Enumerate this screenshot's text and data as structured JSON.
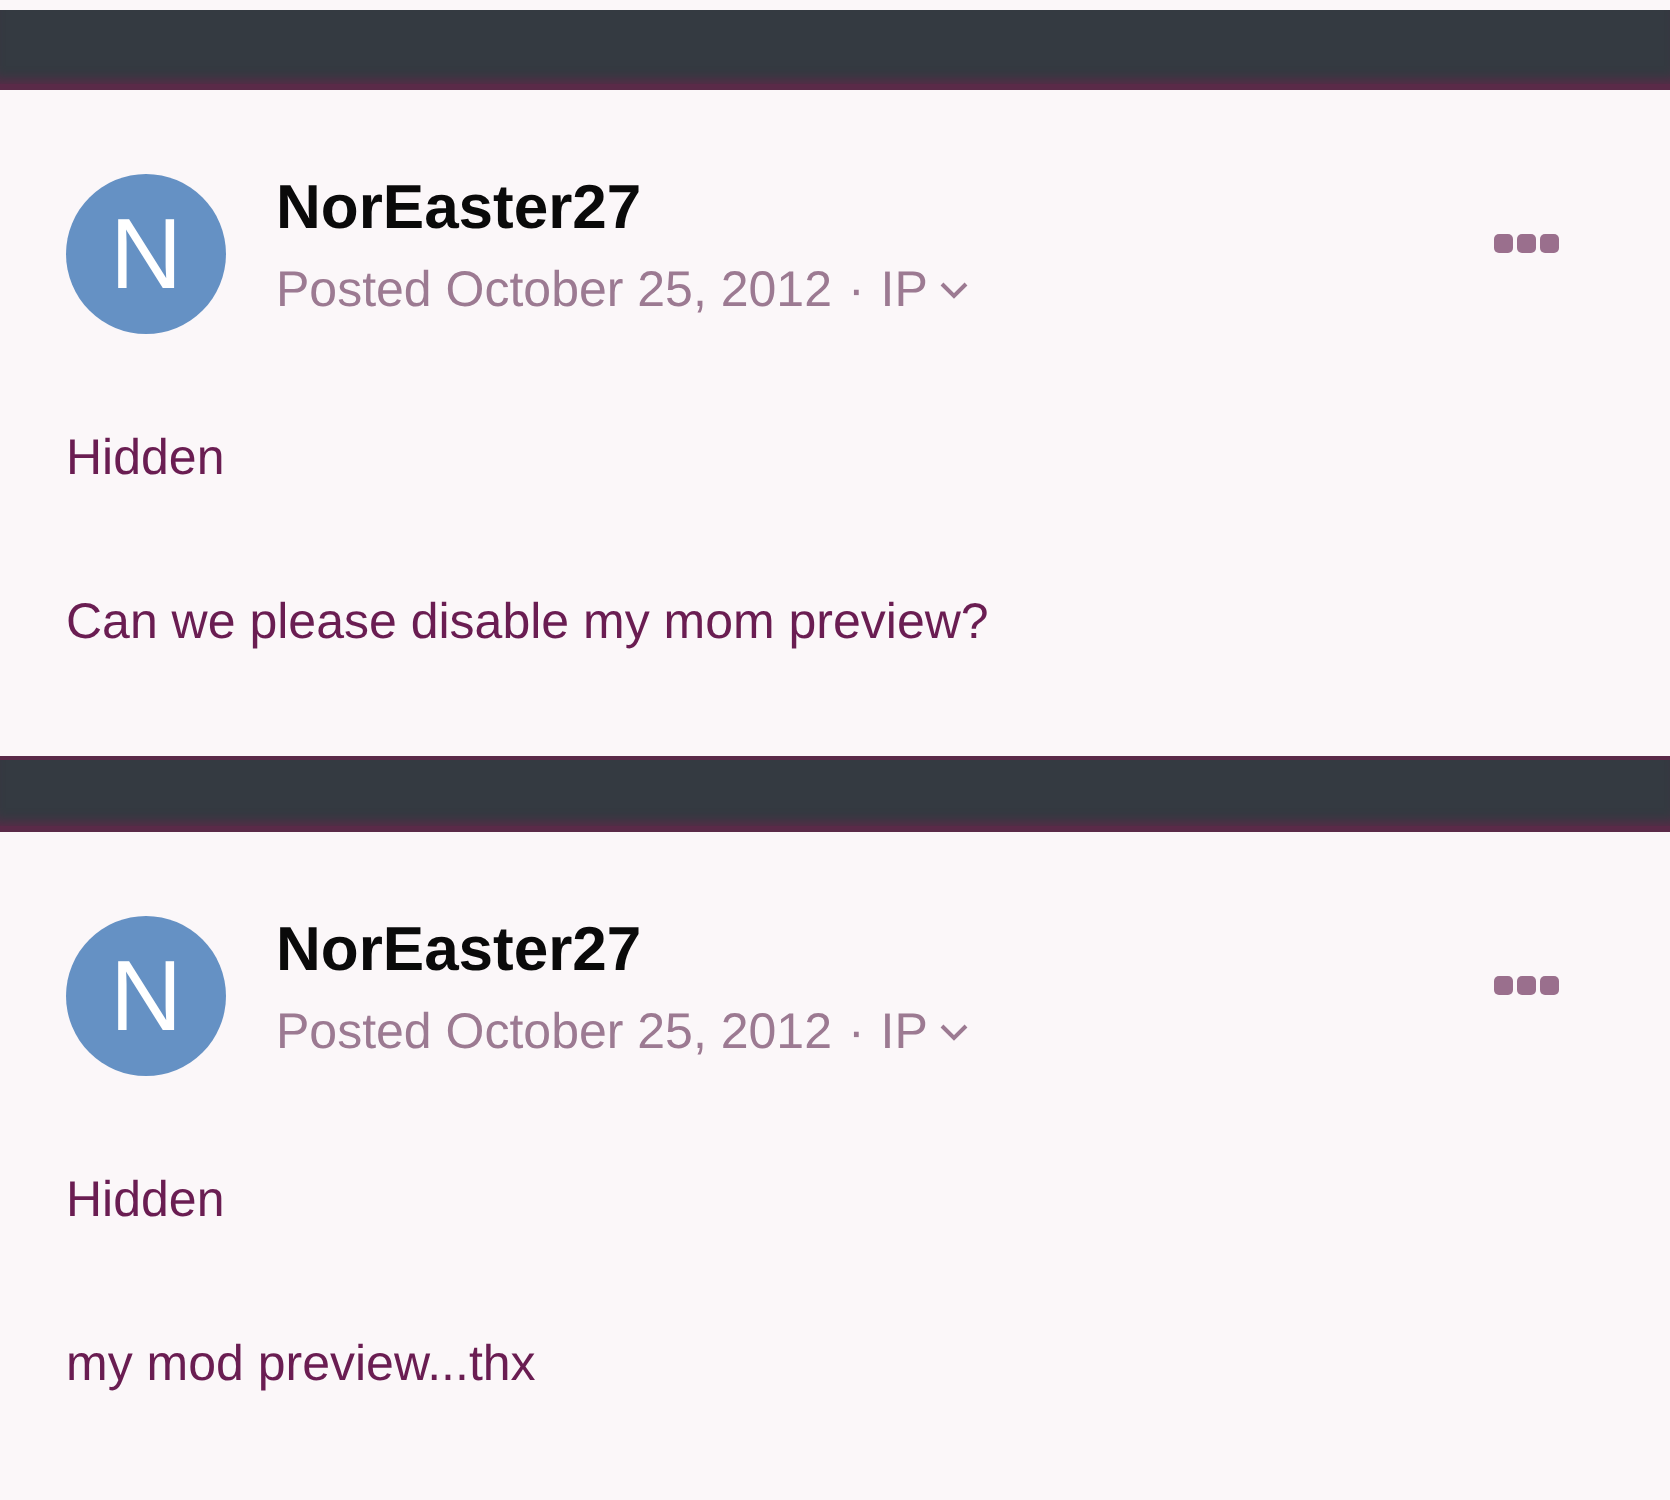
{
  "posts": [
    {
      "avatar_letter": "N",
      "author": "NorEaster27",
      "posted": "Posted October 25, 2012",
      "separator": "·",
      "ip": "IP",
      "status": "Hidden",
      "body": "Can we please disable my mom preview?"
    },
    {
      "avatar_letter": "N",
      "author": "NorEaster27",
      "posted": "Posted October 25, 2012",
      "separator": "·",
      "ip": "IP",
      "status": "Hidden",
      "body": "my mod preview...thx"
    }
  ]
}
